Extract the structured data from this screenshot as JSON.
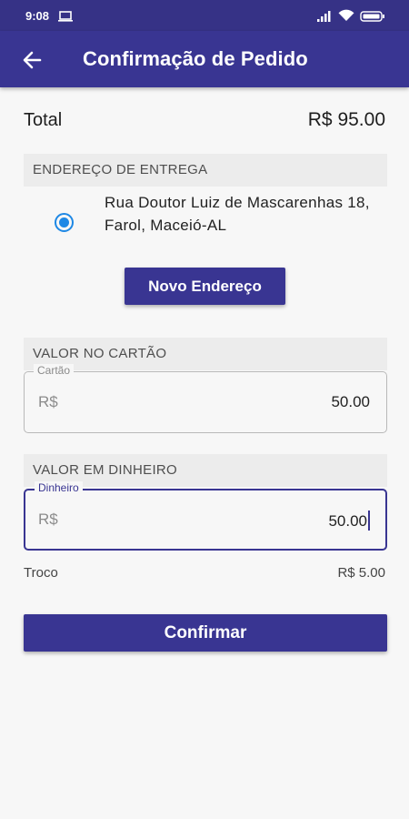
{
  "status_bar": {
    "time": "9:08",
    "icons": [
      "laptop-icon",
      "signal-icon",
      "wifi-icon",
      "battery-icon"
    ]
  },
  "app_bar": {
    "back_icon": "arrow-left-icon",
    "title": "Confirmação de Pedido"
  },
  "total": {
    "label": "Total",
    "value": "R$ 95.00"
  },
  "delivery": {
    "header": "ENDEREÇO DE ENTREGA",
    "address": "Rua Doutor Luiz de Mascarenhas 18, Farol, Maceió-AL",
    "selected": true,
    "new_address_button": "Novo Endereço"
  },
  "card_payment": {
    "header": "VALOR NO CARTÃO",
    "field_label": "Cartão",
    "prefix": "R$",
    "value": "50.00"
  },
  "cash_payment": {
    "header": "VALOR EM DINHEIRO",
    "field_label": "Dinheiro",
    "prefix": "R$",
    "value": "50.00"
  },
  "change": {
    "label": "Troco",
    "value": "R$ 5.00"
  },
  "confirm_button": "Confirmar",
  "colors": {
    "primary": "#393592",
    "status_bar": "#363286",
    "radio": "#1e88e5",
    "background": "#f7f7f7",
    "section_header_bg": "#ececec"
  }
}
